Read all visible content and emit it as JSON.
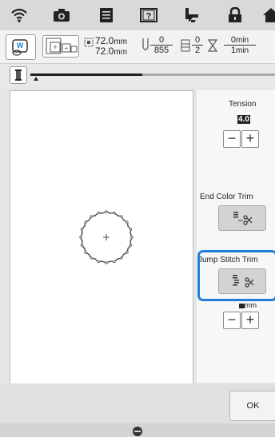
{
  "info": {
    "size_w": "72.0",
    "size_h": "72.0",
    "size_unit": "mm",
    "stitch_current": "0",
    "stitch_total": "855",
    "color_current": "0",
    "color_total": "2",
    "time_current": "0",
    "time_total": "1",
    "time_unit": "min"
  },
  "tension": {
    "label": "Tension",
    "value": "4.0",
    "minus": "−",
    "plus": "+"
  },
  "end_color_trim": {
    "label": "End Color Trim"
  },
  "jump_stitch_trim": {
    "label": "Jump Stitch Trim",
    "unit": "mm",
    "minus": "−",
    "plus": "+"
  },
  "buttons": {
    "ok": "OK"
  },
  "icons": {
    "wifi": "wifi-icon",
    "camera": "camera-icon",
    "document": "document-icon",
    "help": "help-icon",
    "needle_mode": "needle-mode-icon",
    "lock": "lock-icon",
    "home": "home-icon",
    "spool": "thread-spool-icon",
    "scissors": "scissors-icon",
    "sew": "sewing-machine-icon"
  },
  "accent_color": "#1e7fd8"
}
